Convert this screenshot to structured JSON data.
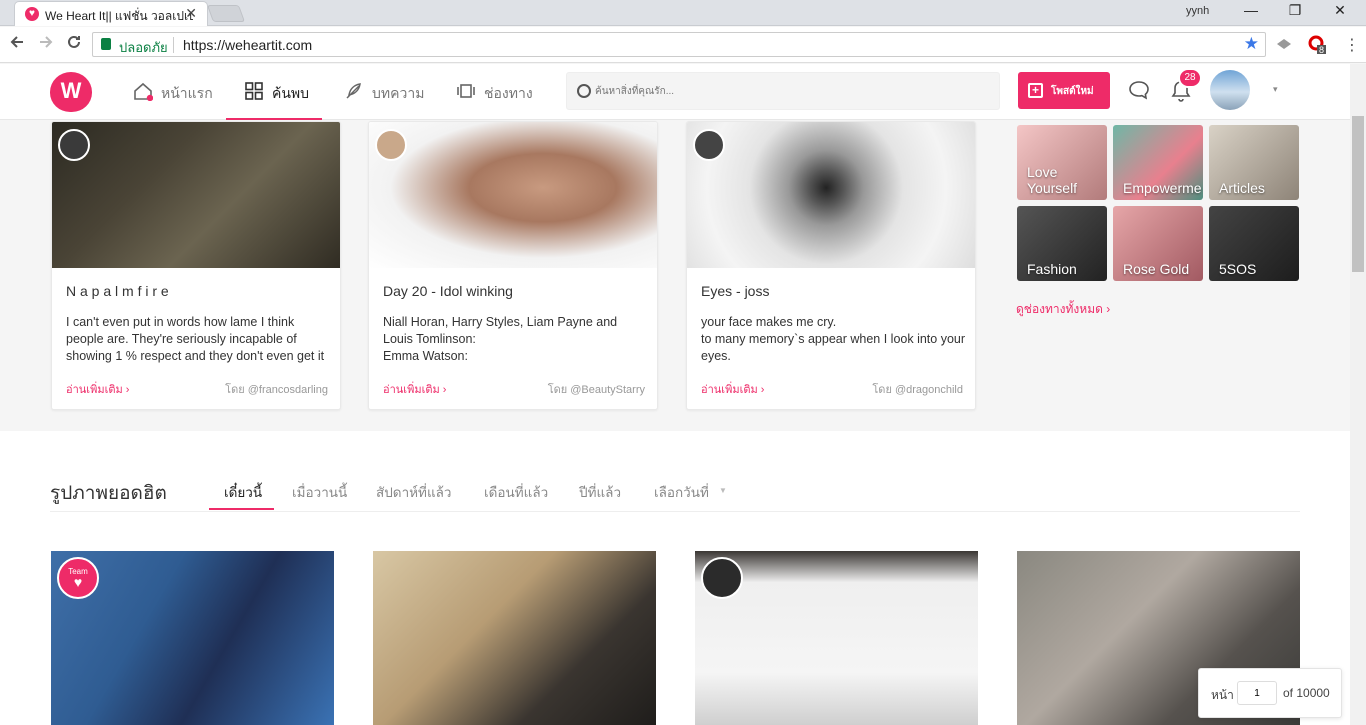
{
  "browser": {
    "tab_title": "We Heart It|| แฟชั่น วอลเปเปอร์",
    "tab_close": "✕",
    "user": "yynh",
    "win_minimize": "—",
    "win_restore": "❐",
    "win_close": "✕",
    "security_label": "ปลอดภัย",
    "url": "https://weheartit.com",
    "ext_badge": "8"
  },
  "header": {
    "logo": "W",
    "nav": [
      {
        "label": "หน้าแรก"
      },
      {
        "label": "ค้นพบ"
      },
      {
        "label": "บทความ"
      },
      {
        "label": "ช่องทาง"
      }
    ],
    "search_placeholder": "ค้นหาสิ่งที่คุณรัก...",
    "post_label": "โพสต์ใหม่",
    "notif_count": "28",
    "caret": "▾"
  },
  "cards": [
    {
      "title": "N a p a l m f i r e",
      "desc": "I can't even put in words how lame I think people are. They're seriously incapable of showing 1 % respect and they don't even get it",
      "more": "อ่านเพิ่มเติม ›",
      "by": "โดย @francosdarling"
    },
    {
      "title": "Day 20 - Idol winking",
      "desc": "Niall Horan, Harry Styles, Liam Payne and Louis Tomlinson:\nEmma Watson:",
      "more": "อ่านเพิ่มเติม ›",
      "by": "โดย @BeautyStarry"
    },
    {
      "title": "Eyes - joss",
      "desc": "your face makes me cry.\nto many memory`s appear when I look into your eyes.",
      "more": "อ่านเพิ่มเติม ›",
      "by": "โดย @dragonchild"
    }
  ],
  "channels": [
    {
      "label": "Love\nYourself"
    },
    {
      "label": "Empowerme"
    },
    {
      "label": "Articles"
    },
    {
      "label": "Fashion"
    },
    {
      "label": "Rose Gold"
    },
    {
      "label": "5SOS"
    }
  ],
  "all_channels": "ดูช่องทางทั้งหมด ›",
  "popular": {
    "title": "รูปภาพยอดฮิต",
    "tabs": [
      {
        "label": "เดี๋ยวนี้"
      },
      {
        "label": "เมื่อวานนี้"
      },
      {
        "label": "สัปดาห์ที่แล้ว"
      },
      {
        "label": "เดือนที่แล้ว"
      },
      {
        "label": "ปีที่แล้ว"
      },
      {
        "label": "เลือกวันที่"
      }
    ],
    "team_badge": "Team"
  },
  "pager": {
    "label": "หน้า",
    "value": "1",
    "of": "of 10000"
  },
  "colors": {
    "brand": "#ee2b68"
  }
}
